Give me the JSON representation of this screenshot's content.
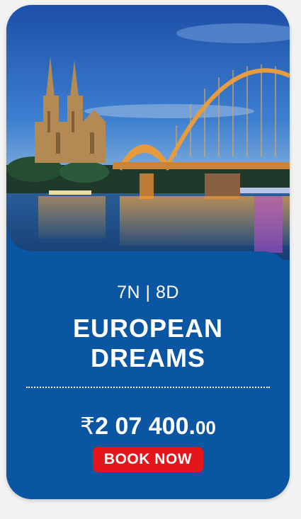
{
  "package": {
    "duration": "7N | 8D",
    "title_line1": "EUROPEAN",
    "title_line2": "DREAMS",
    "price_currency": "₹",
    "price_main": "2 07 400.",
    "price_decimal": "00",
    "book_label": "BOOK NOW"
  },
  "colors": {
    "panel": "#0b56a3",
    "button": "#e3171b",
    "text": "#ffffff"
  }
}
